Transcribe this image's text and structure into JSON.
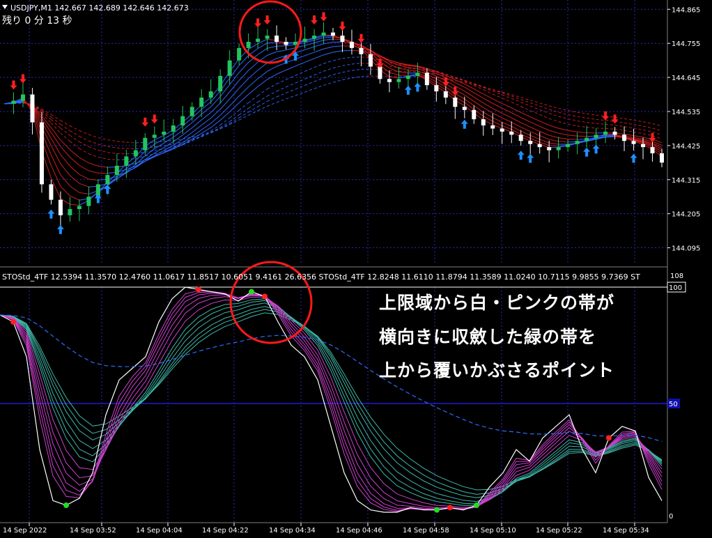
{
  "header": {
    "symbol_line": "USDJPY,M1  142.667 142.689 142.646 142.673",
    "countdown": "残り 0 分 13 秒"
  },
  "indicator": {
    "label": "STOStd_4TF 12.5394 11.3570 12.4760 11.0617 11.8517 10.6051 9.4161 26.6356  STOStd_4TF 12.8248 11.6110 11.8794 11.3589 11.0240 10.7115 9.9855 9.7369  ST",
    "level_top": "108",
    "level_100": "100",
    "level_mid_marker": "50",
    "level_bottom_marker": "0"
  },
  "callout": {
    "lines": [
      "上限域から白・ピンクの帯が",
      "横向きに収斂した緑の帯を",
      "上から覆いかぶさるポイント"
    ]
  },
  "colors": {
    "background": "#000000",
    "grid": "#2a2ab0",
    "bull_candle": "#22c55e",
    "bear_candle": "#ffffff",
    "up_arrow": "#1e90ff",
    "down_arrow": "#ff2020",
    "ribbon_red": "#d22020",
    "ribbon_blue": "#2f6bff",
    "osc_white": "#ffffff",
    "osc_pink": "#d040d0",
    "osc_teal": "#3fb8a8",
    "highlight_circle": "#ff1a1a",
    "callout_text": "#ffffff"
  },
  "chart_data": [
    {
      "type": "candlestick",
      "title": "USDJPY,M1",
      "y_ticks": [
        "144.865",
        "144.755",
        "144.645",
        "144.535",
        "144.425",
        "144.315",
        "144.205",
        "144.095"
      ],
      "ylim": [
        144.04,
        144.895
      ],
      "x_ticks": [
        "14 Sep 2022",
        "14 Sep 03:52",
        "14 Sep 04:04",
        "14 Sep 04:22",
        "14 Sep 04:34",
        "14 Sep 04:46",
        "14 Sep 04:58",
        "14 Sep 05:10",
        "14 Sep 05:22",
        "14 Sep 05:34"
      ],
      "series": [
        {
          "values": [
            144.56,
            144.57,
            144.59,
            144.5,
            144.3,
            144.25,
            144.2,
            144.22,
            144.23,
            144.26,
            144.3,
            144.33,
            144.36,
            144.39,
            144.41,
            144.45,
            144.46,
            144.47,
            144.49,
            144.52,
            144.55,
            144.58,
            144.6,
            144.65,
            144.7,
            144.74,
            144.76,
            144.77,
            144.78,
            144.76,
            144.75,
            144.76,
            144.77,
            144.78,
            144.79,
            144.78,
            144.76,
            144.74,
            144.72,
            144.68,
            144.64,
            144.63,
            144.64,
            144.65,
            144.66,
            144.62,
            144.6,
            144.58,
            144.55,
            144.54,
            144.51,
            144.49,
            144.48,
            144.47,
            144.46,
            144.44,
            144.43,
            144.42,
            144.41,
            144.42,
            144.43,
            144.44,
            144.45,
            144.46,
            144.47,
            144.46,
            144.44,
            144.43,
            144.42,
            144.4,
            144.37
          ]
        }
      ]
    },
    {
      "type": "line",
      "title": "STOStd_4TF",
      "ylim": [
        0,
        108
      ],
      "series": [
        {
          "values": [
            88,
            85,
            70,
            30,
            8,
            6,
            9,
            20,
            45,
            60,
            65,
            70,
            85,
            95,
            100,
            99,
            98,
            97,
            94,
            98,
            96,
            85,
            75,
            70,
            60,
            40,
            20,
            8,
            4,
            3,
            3,
            5,
            4,
            4,
            5,
            4,
            6,
            14,
            20,
            30,
            25,
            35,
            40,
            45,
            30,
            20,
            35,
            40,
            38,
            18,
            8
          ]
        }
      ]
    }
  ]
}
